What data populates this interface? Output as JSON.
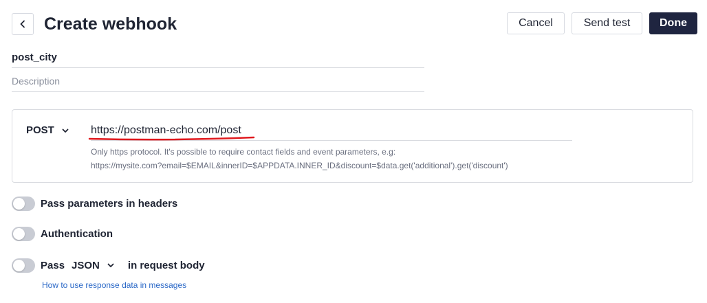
{
  "header": {
    "title": "Create webhook",
    "cancel_label": "Cancel",
    "send_test_label": "Send test",
    "done_label": "Done"
  },
  "form": {
    "name_value": "post_city",
    "description_placeholder": "Description"
  },
  "request": {
    "method": "POST",
    "url": "https://postman-echo.com/post",
    "hint_line1": "Only https protocol. It's possible to require contact fields and event parameters, e.g:",
    "hint_line2": "https://mysite.com?email=$EMAIL&innerID=$APPDATA.INNER_ID&discount=$data.get('additional').get('discount')"
  },
  "options": {
    "headers_label": "Pass parameters in headers",
    "auth_label": "Authentication",
    "pass_label": "Pass",
    "body_format": "JSON",
    "body_suffix": "in request body",
    "help_link": "How to use response data in messages"
  },
  "icons": {
    "back": "chevron-left-icon",
    "dropdown": "chevron-down-icon"
  },
  "colors": {
    "primary": "#1f2540",
    "link": "#2a68c7",
    "annotation": "#e0191e",
    "toggle_off": "#c9ccd4"
  }
}
